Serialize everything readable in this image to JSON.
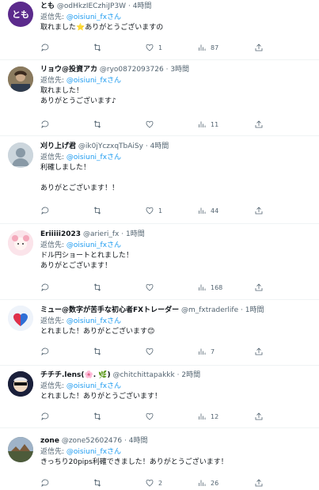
{
  "replies": [
    {
      "name": "とも",
      "handle": "@odHkzIECzhiJP3W",
      "time": "4時間",
      "reply_to_label": "返信先:",
      "reply_to_handle": "@oisiuni_fxさん",
      "body": "取れました⭐ありがとうございますの",
      "avatar_text": "とも",
      "avatar_color": "#5b2a8c",
      "counts": {
        "reply": "",
        "retweet": "",
        "like": "1",
        "views": "87"
      }
    },
    {
      "name": "リョウ@投資アカ",
      "handle": "@ryo0872093726",
      "time": "3時間",
      "reply_to_label": "返信先:",
      "reply_to_handle": "@oisiuni_fxさん",
      "body": "取れました！\nありがとうございます♪",
      "avatar_text": "",
      "avatar_color": "#6b5a3e",
      "counts": {
        "reply": "",
        "retweet": "",
        "like": "",
        "views": "11"
      }
    },
    {
      "name": "刈り上げ君",
      "handle": "@ik0jYczxqTbAiSy",
      "time": "4時間",
      "reply_to_label": "返信先:",
      "reply_to_handle": "@oisiuni_fxさん",
      "body": "利確しました！\n\nありがとございます！！",
      "avatar_text": "",
      "avatar_color": "#ccd6dd",
      "counts": {
        "reply": "",
        "retweet": "",
        "like": "1",
        "views": "44"
      }
    },
    {
      "name": "Eriiiii2023",
      "handle": "@arieri_fx",
      "time": "1時間",
      "reply_to_label": "返信先:",
      "reply_to_handle": "@oisiuni_fxさん",
      "body": "ドル円ショートとれました！\nありがとございます！",
      "avatar_text": "",
      "avatar_color": "#f6d6de",
      "counts": {
        "reply": "",
        "retweet": "",
        "like": "",
        "views": "168"
      }
    },
    {
      "name": "ミュー@数字が苦手な初心者FXトレーダー",
      "handle": "@m_fxtraderlife",
      "time": "1時間",
      "reply_to_label": "返信先:",
      "reply_to_handle": "@oisiuni_fxさん",
      "body": "とれました！ありがとございます😊",
      "avatar_text": "",
      "avatar_color": "#e8eef6",
      "counts": {
        "reply": "",
        "retweet": "",
        "like": "",
        "views": "7"
      }
    },
    {
      "name": "チチチ.lens(🌸. 🌿)",
      "handle": "@chitchittapakkk",
      "time": "2時間",
      "reply_to_label": "返信先:",
      "reply_to_handle": "@oisiuni_fxさん",
      "body": "とれました！ありがとうございます！",
      "avatar_text": "",
      "avatar_color": "#1a1f3a",
      "counts": {
        "reply": "",
        "retweet": "",
        "like": "",
        "views": "12"
      }
    },
    {
      "name": "zone",
      "handle": "@zone52602476",
      "time": "4時間",
      "reply_to_label": "返信先:",
      "reply_to_handle": "@oisiuni_fxさん",
      "body": "きっちり20pips利確できました！ありがとうございます！",
      "avatar_text": "",
      "avatar_color": "#5a6a4a",
      "counts": {
        "reply": "",
        "retweet": "",
        "like": "2",
        "views": "26"
      }
    }
  ]
}
